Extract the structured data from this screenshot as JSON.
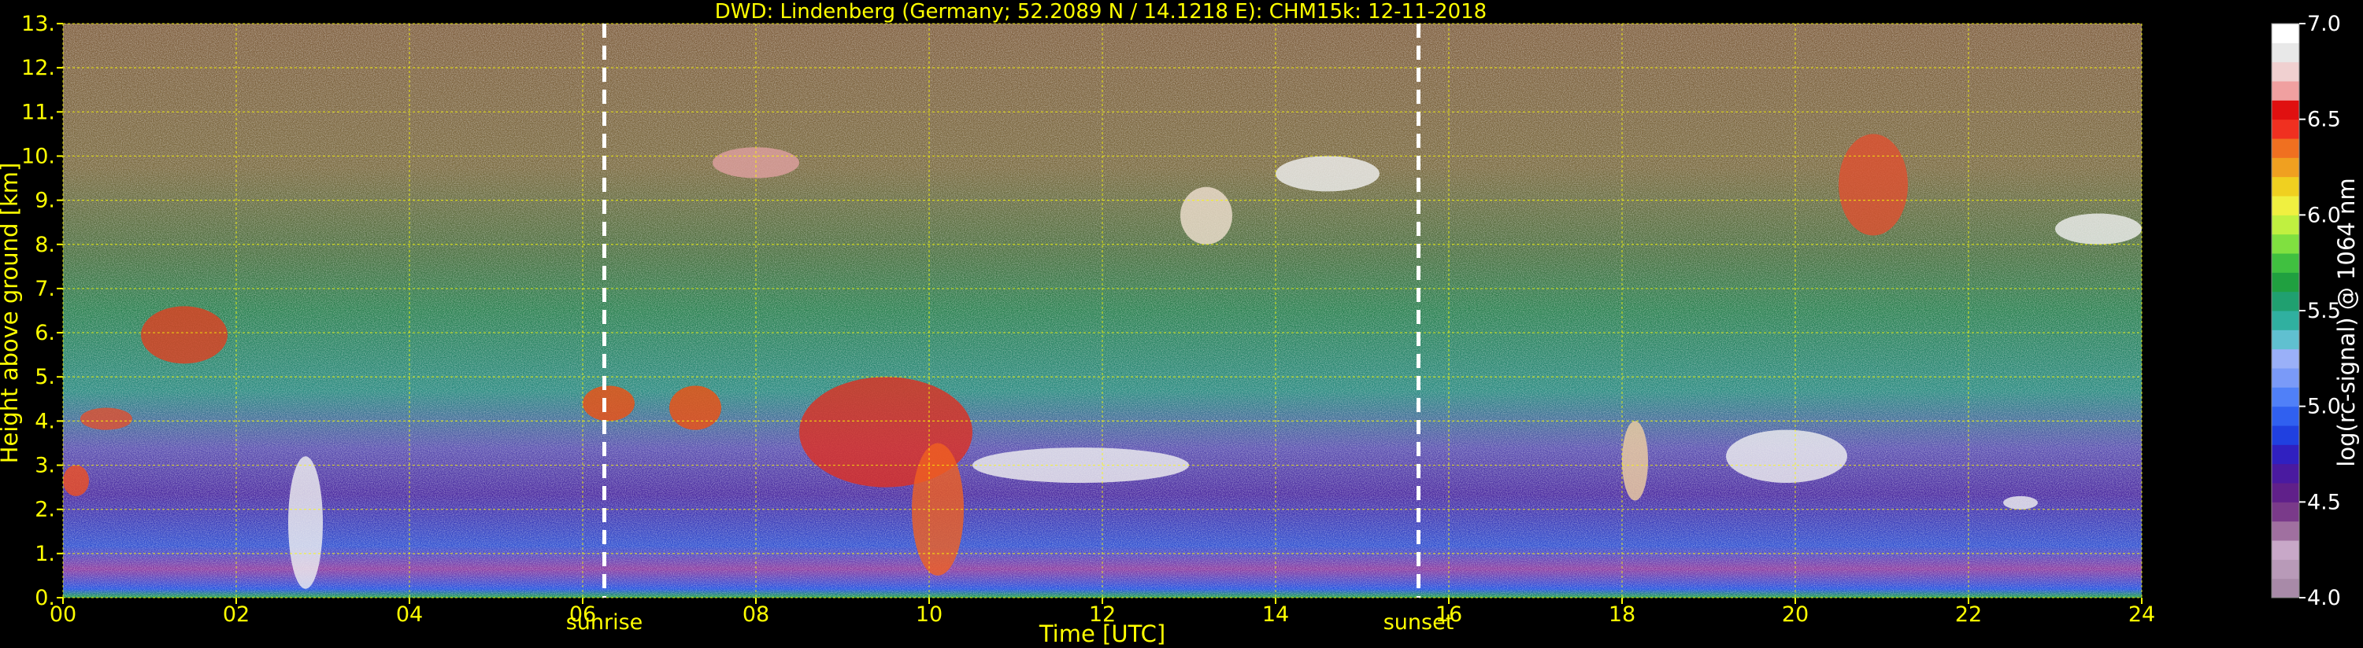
{
  "chart_data": {
    "type": "heatmap",
    "title": "DWD: Lindenberg (Germany; 52.2089 N / 14.1218 E):    CHM15k: 12-11-2018",
    "xlabel": "Time [UTC]",
    "ylabel": "Height above ground [km]",
    "xlim": [
      0,
      24
    ],
    "ylim": [
      0,
      13
    ],
    "xticks": [
      "00",
      "02",
      "04",
      "06",
      "08",
      "10",
      "12",
      "14",
      "16",
      "18",
      "20",
      "22",
      "24"
    ],
    "yticks": [
      "0.",
      "1.",
      "2.",
      "3.",
      "4.",
      "5.",
      "6.",
      "7.",
      "8.",
      "9.",
      "10.",
      "11.",
      "12.",
      "13."
    ],
    "grid": true,
    "colorbar": {
      "label": "log(rc-signal) @ 1064 nm",
      "range": [
        4.0,
        7.0
      ],
      "ticks": [
        "4.0",
        "4.5",
        "5.0",
        "5.5",
        "6.0",
        "6.5",
        "7.0"
      ],
      "colors": [
        "#a88aa8",
        "#b89ab8",
        "#c8a8c8",
        "#a070a0",
        "#7a3a8a",
        "#60208a",
        "#4a1aa0",
        "#3020c0",
        "#2040e0",
        "#3060f0",
        "#5080f8",
        "#7a9af8",
        "#9ab0f8",
        "#60c0d0",
        "#30b0a0",
        "#20a070",
        "#20a040",
        "#40c040",
        "#80e040",
        "#c0f040",
        "#f0f040",
        "#f0d020",
        "#f0a020",
        "#f07020",
        "#f03020",
        "#e01010",
        "#f0a0a0",
        "#f0d0d0",
        "#e8e8e8",
        "#ffffff"
      ]
    },
    "markers": [
      {
        "label": "sunrise",
        "x": 6.25
      },
      {
        "label": "sunset",
        "x": 15.65
      }
    ]
  }
}
